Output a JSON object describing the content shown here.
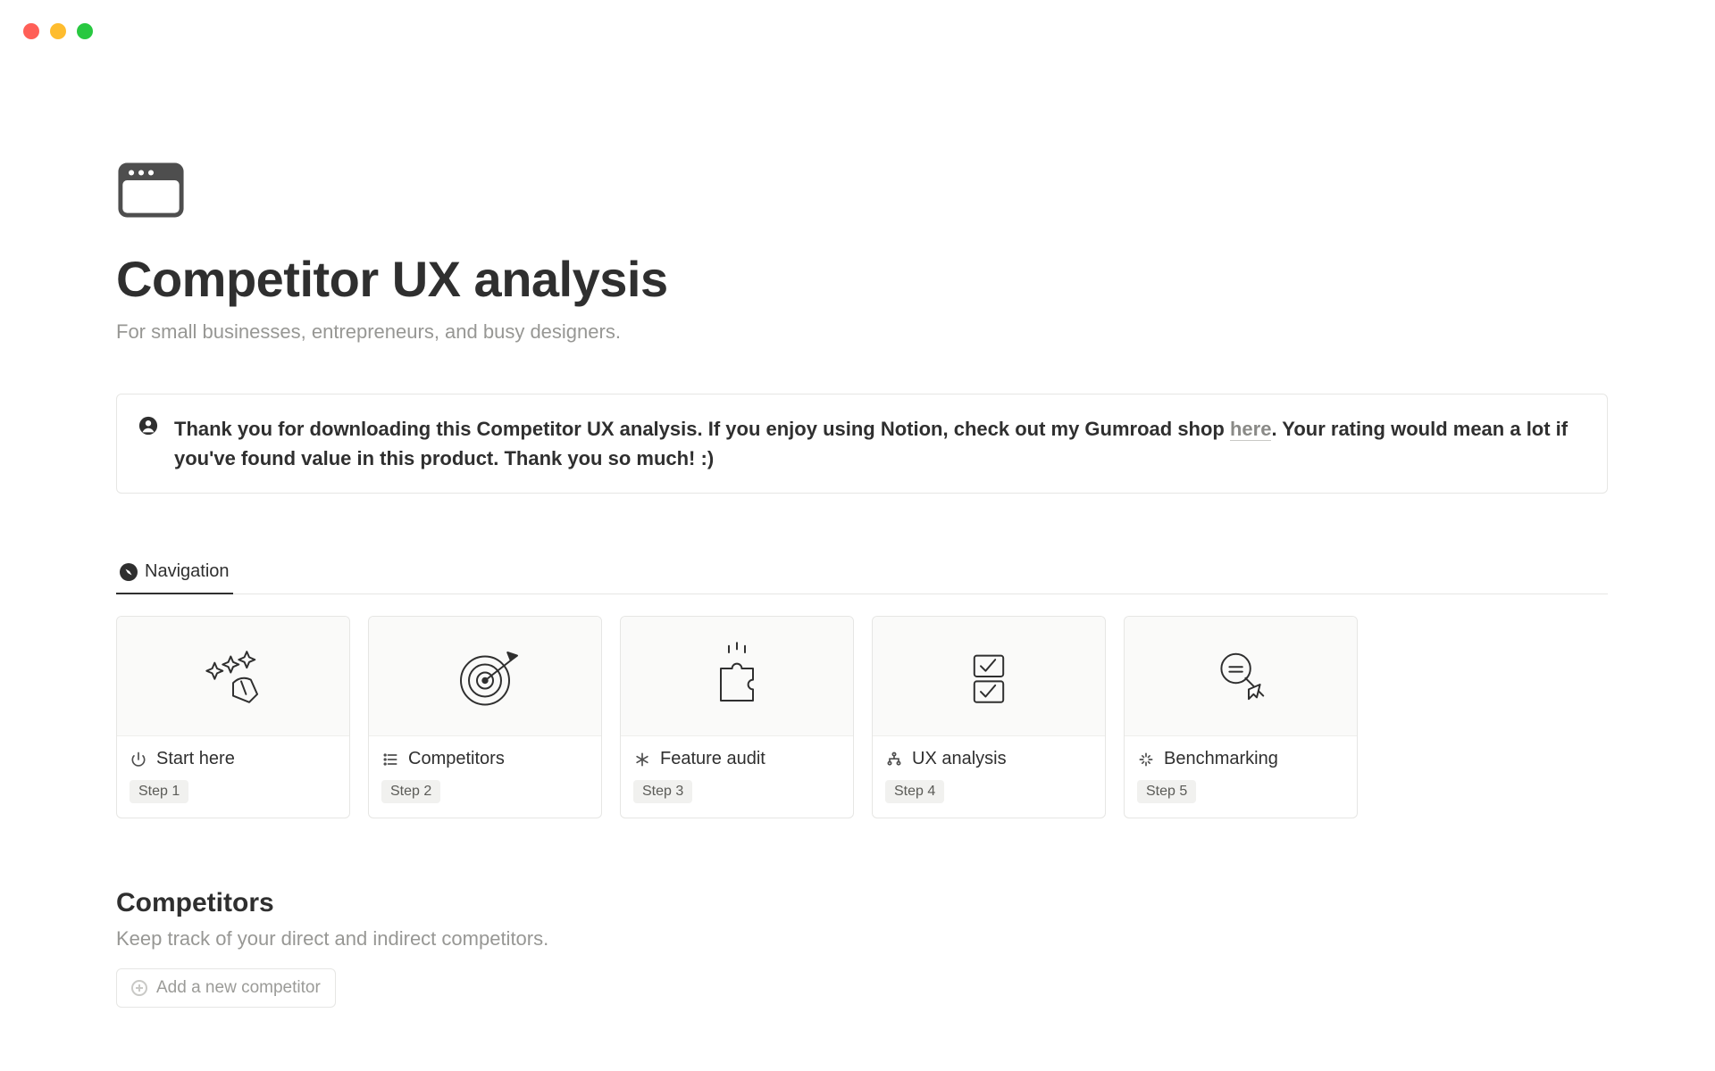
{
  "header": {
    "title": "Competitor UX analysis",
    "subtitle": "For small businesses, entrepreneurs, and busy designers."
  },
  "callout": {
    "prefix": "Thank you for downloading this Competitor UX analysis. If you enjoy using Notion, check out my Gumroad shop ",
    "link_text": "here",
    "suffix": ". Your rating would mean a lot if you've found value in this product. Thank you so much! :)"
  },
  "tabs": {
    "active": "Navigation"
  },
  "nav_cards": [
    {
      "label": "Start here",
      "step": "Step 1",
      "icon": "power-icon"
    },
    {
      "label": "Competitors",
      "step": "Step 2",
      "icon": "list-icon"
    },
    {
      "label": "Feature audit",
      "step": "Step 3",
      "icon": "asterisk-icon"
    },
    {
      "label": "UX analysis",
      "step": "Step 4",
      "icon": "sitemap-icon"
    },
    {
      "label": "Benchmarking",
      "step": "Step 5",
      "icon": "sparkle-icon"
    }
  ],
  "competitors": {
    "heading": "Competitors",
    "subheading": "Keep track of your direct and indirect competitors.",
    "add_button": "Add a new competitor"
  }
}
